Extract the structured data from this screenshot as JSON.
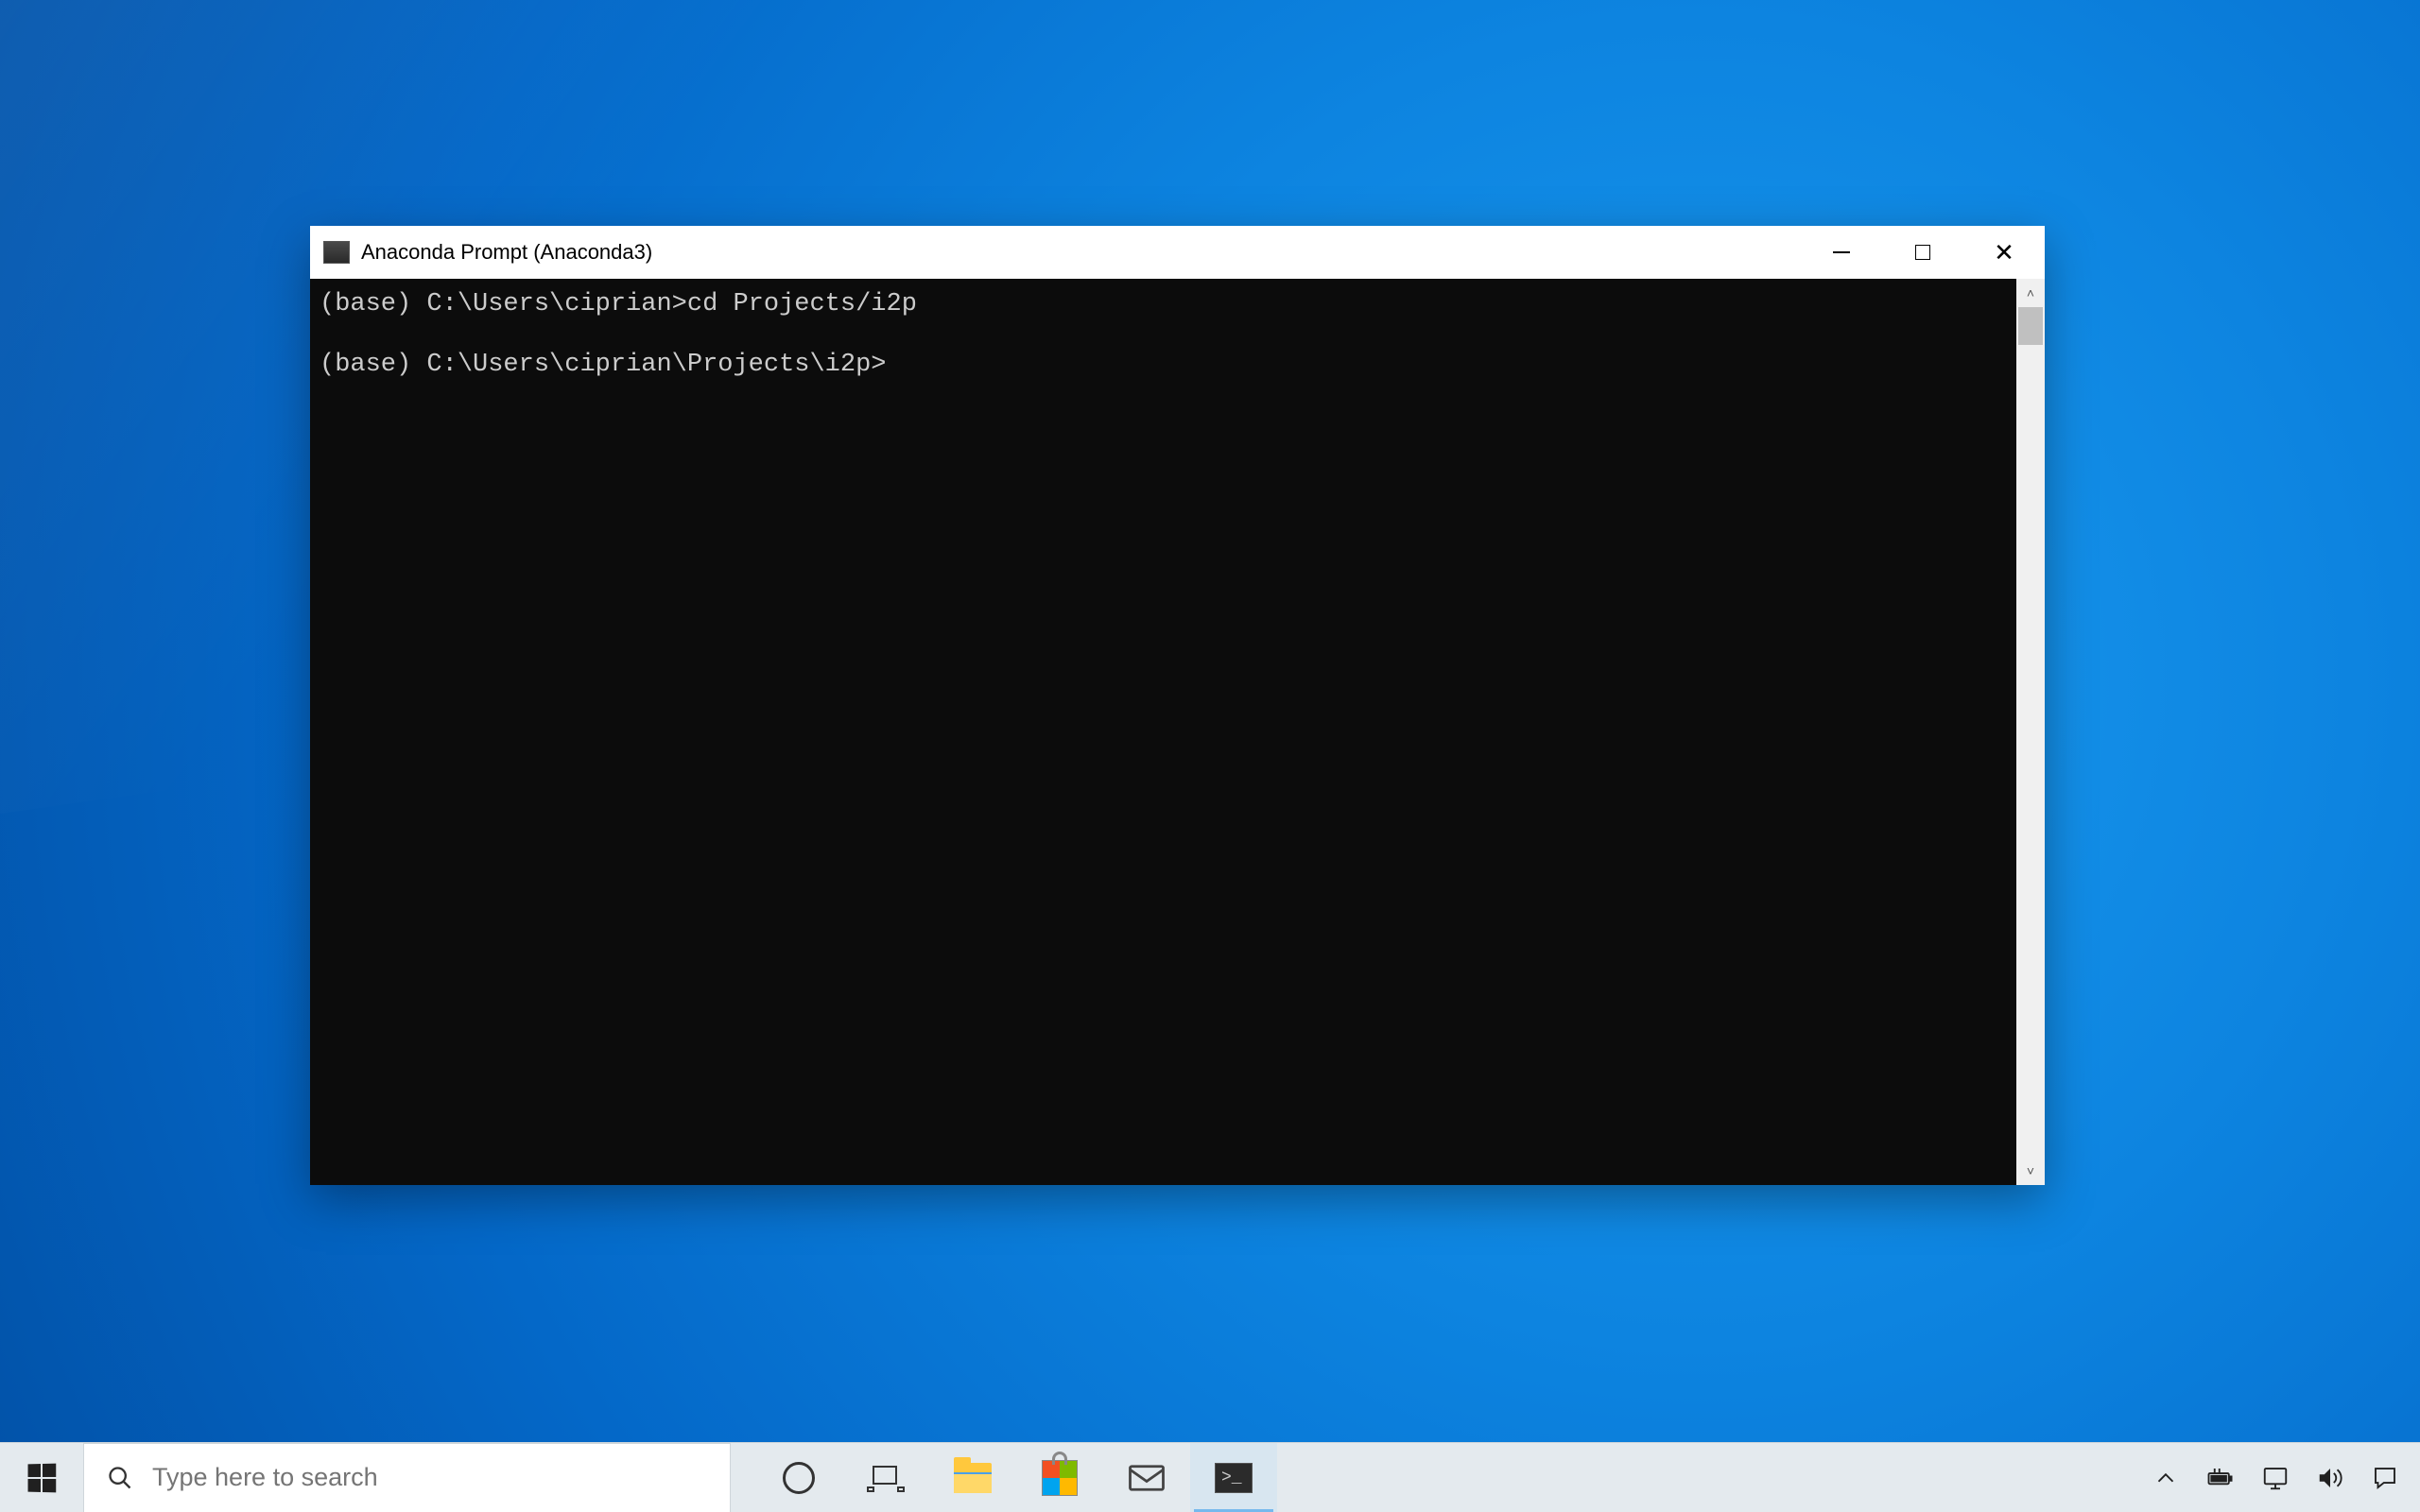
{
  "window": {
    "title": "Anaconda Prompt (Anaconda3)"
  },
  "terminal": {
    "lines": [
      "(base) C:\\Users\\ciprian>cd Projects/i2p",
      "",
      "(base) C:\\Users\\ciprian\\Projects\\i2p>"
    ]
  },
  "taskbar": {
    "search_placeholder": "Type here to search"
  }
}
